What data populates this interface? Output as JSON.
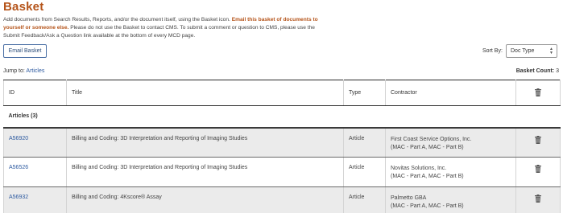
{
  "page": {
    "title": "Basket",
    "intro_part1": "Add documents from Search Results, Reports, and/or the document itself, using the Basket icon. ",
    "intro_emph": "Email this basket of documents to yourself or someone else.",
    "intro_part2": " Please do not use the Basket to contact CMS. To submit a comment or question to CMS, please use the Submit Feedback/Ask a Question link available at the bottom of every MCD page."
  },
  "toolbar": {
    "email_button": "Email Basket",
    "sort_label": "Sort By:",
    "sort_value": "Doc Type"
  },
  "jump": {
    "label": "Jump to:",
    "link": "Articles"
  },
  "count": {
    "label": "Basket Count:",
    "value": "3"
  },
  "table": {
    "headers": {
      "id": "ID",
      "title": "Title",
      "type": "Type",
      "contractor": "Contractor"
    },
    "group_label": "Articles (3)",
    "rows": [
      {
        "id": "A56920",
        "title": "Billing and Coding: 3D Interpretation and Reporting of Imaging Studies",
        "type": "Article",
        "contractor": "First Coast Service Options, Inc.",
        "contractor_detail": "(MAC - Part A, MAC - Part B)"
      },
      {
        "id": "A56526",
        "title": "Billing and Coding: 3D Interpretation and Reporting of Imaging Studies",
        "type": "Article",
        "contractor": "Novitas Solutions, Inc.",
        "contractor_detail": "(MAC - Part A, MAC - Part B)"
      },
      {
        "id": "A56932",
        "title": "Billing and Coding: 4Kscore® Assay",
        "type": "Article",
        "contractor": "Palmetto GBA",
        "contractor_detail": "(MAC - Part A, MAC - Part B)"
      }
    ]
  },
  "colors": {
    "accent": "#b5541a",
    "link": "#2d5aa0",
    "row_shade": "#ebebeb"
  },
  "icons": {
    "delete": "trash-icon",
    "sort": "sort-arrows-icon"
  }
}
